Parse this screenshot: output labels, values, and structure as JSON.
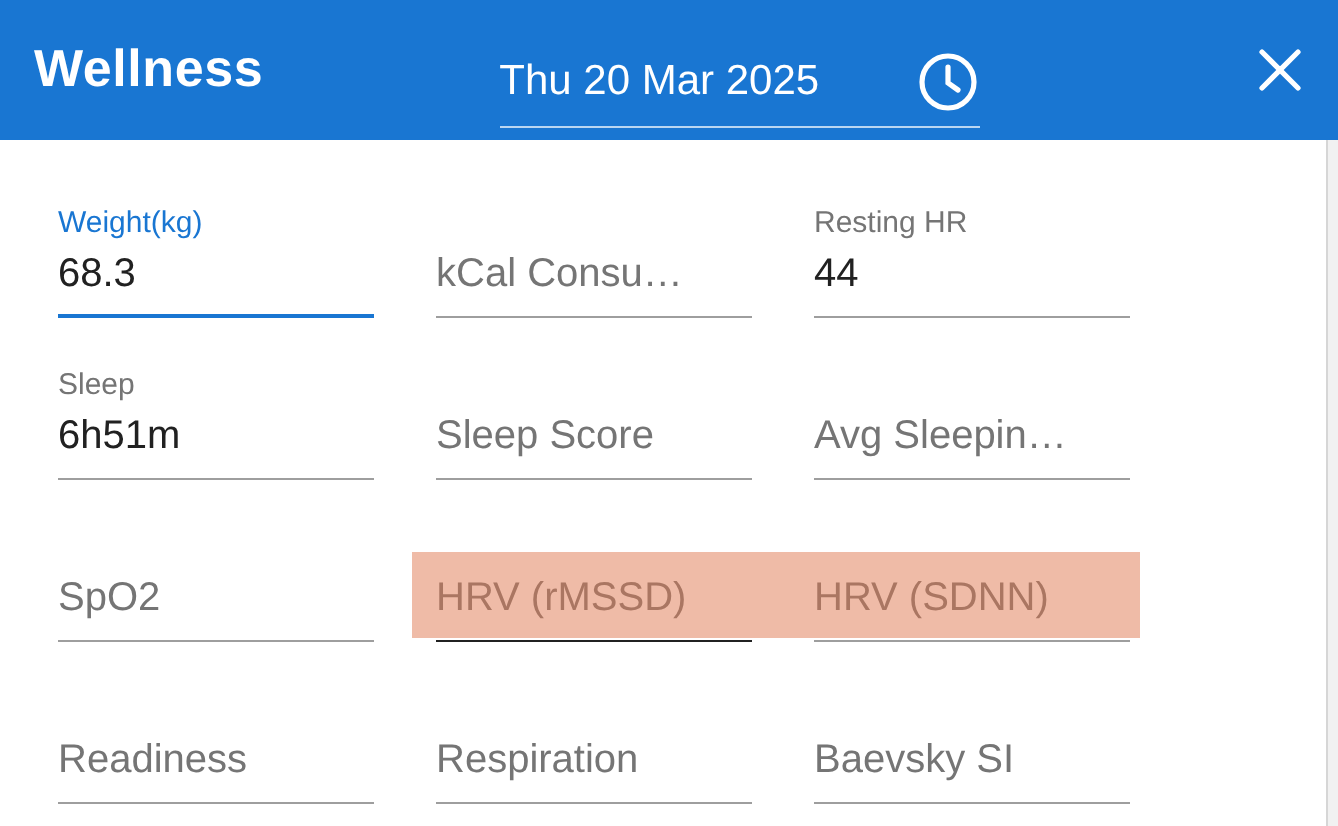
{
  "header": {
    "title": "Wellness",
    "date": "Thu 20 Mar 2025"
  },
  "fields": [
    {
      "label": "Weight(kg)",
      "value": "68.3",
      "focused": true,
      "highlighted": false,
      "hovered": false
    },
    {
      "placeholder": "kCal Consu…",
      "focused": false,
      "highlighted": false,
      "hovered": false
    },
    {
      "label": "Resting HR",
      "value": "44",
      "focused": false,
      "highlighted": false,
      "hovered": false
    },
    {
      "label": "Sleep",
      "value": "6h51m",
      "focused": false,
      "highlighted": false,
      "hovered": false
    },
    {
      "placeholder": "Sleep Score",
      "focused": false,
      "highlighted": false,
      "hovered": false
    },
    {
      "placeholder": "Avg Sleepin…",
      "focused": false,
      "highlighted": false,
      "hovered": false
    },
    {
      "placeholder": "SpO2",
      "focused": false,
      "highlighted": false,
      "hovered": false
    },
    {
      "placeholder": "HRV (rMSSD)",
      "focused": false,
      "highlighted": true,
      "hovered": true
    },
    {
      "placeholder": "HRV (SDNN)",
      "focused": false,
      "highlighted": true,
      "hovered": false
    },
    {
      "placeholder": "Readiness",
      "focused": false,
      "highlighted": false,
      "hovered": false
    },
    {
      "placeholder": "Respiration",
      "focused": false,
      "highlighted": false,
      "hovered": false
    },
    {
      "placeholder": "Baevsky SI",
      "focused": false,
      "highlighted": false,
      "hovered": false
    }
  ]
}
